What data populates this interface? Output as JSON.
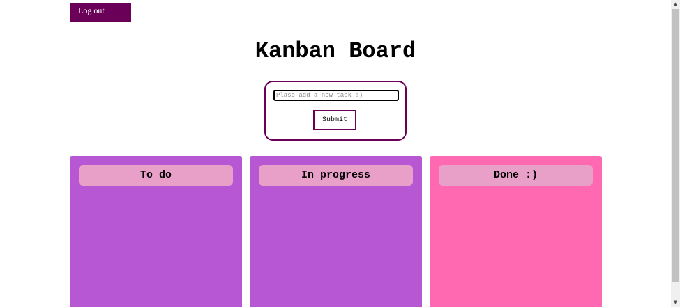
{
  "header": {
    "logout_label": "Log out"
  },
  "page": {
    "title": "Kanban Board"
  },
  "form": {
    "input_placeholder": "Plase add a new task :)",
    "input_value": "",
    "submit_label": "Submit"
  },
  "columns": [
    {
      "title": "To do",
      "color": "#b757d4"
    },
    {
      "title": "In progress",
      "color": "#b757d4"
    },
    {
      "title": "Done :)",
      "color": "#ff69b1"
    }
  ],
  "colors": {
    "accent": "#6b0059",
    "column_header": "#e8a0c8"
  },
  "scrollbar": {
    "up_icon": "scroll-up-arrow-icon",
    "down_icon": "scroll-down-arrow-icon"
  }
}
